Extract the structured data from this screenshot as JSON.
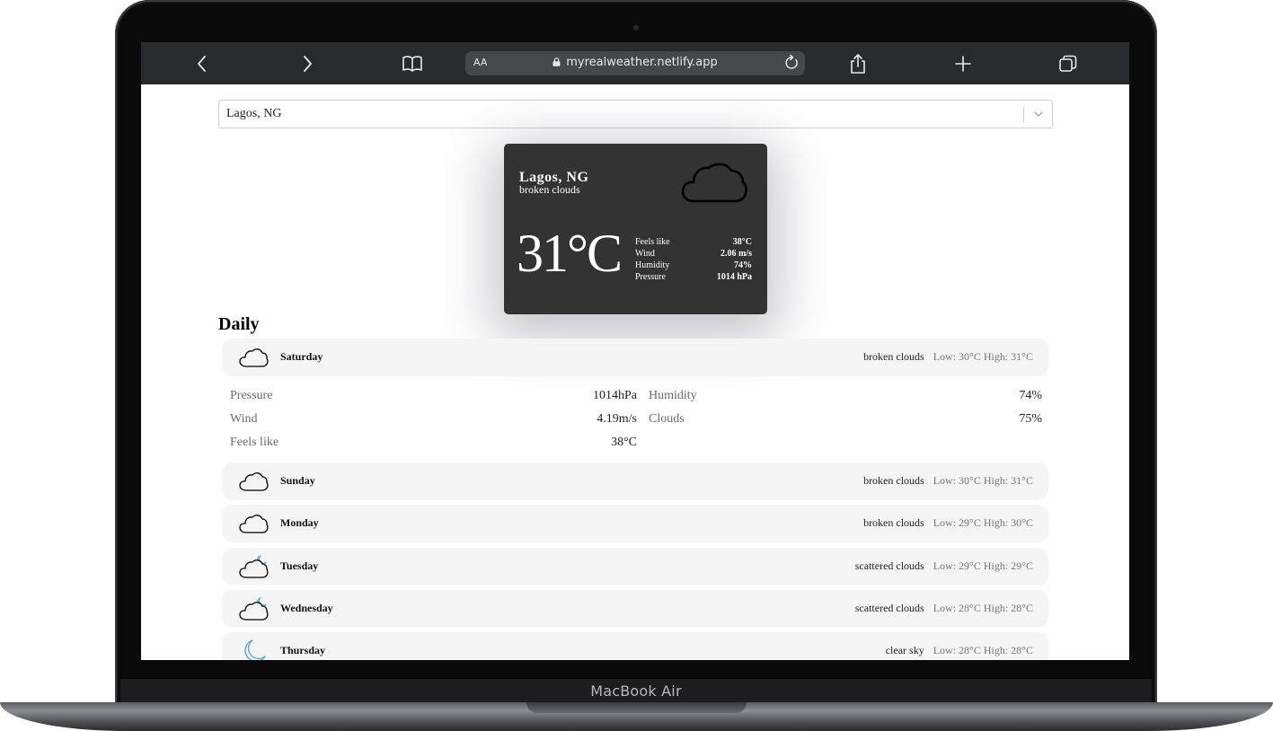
{
  "device": {
    "label": "MacBook Air"
  },
  "browser": {
    "text_size_label": "AA",
    "url": "myrealweather.netlify.app"
  },
  "location_select": {
    "value": "Lagos, NG"
  },
  "current": {
    "city": "Lagos, NG",
    "description": "broken clouds",
    "icon": "cloud-icon",
    "temperature": "31°C",
    "details": [
      {
        "label": "Feels like",
        "value": "38°C"
      },
      {
        "label": "Wind",
        "value": "2.06 m/s"
      },
      {
        "label": "Humidity",
        "value": "74%"
      },
      {
        "label": "Pressure",
        "value": "1014 hPa"
      }
    ]
  },
  "daily": {
    "title": "Daily",
    "expanded_details": {
      "left": [
        {
          "label": "Pressure",
          "value": "1014hPa"
        },
        {
          "label": "Wind",
          "value": "4.19m/s"
        },
        {
          "label": "Feels like",
          "value": "38°C"
        }
      ],
      "right": [
        {
          "label": "Humidity",
          "value": "74%"
        },
        {
          "label": "Clouds",
          "value": "75%"
        }
      ]
    },
    "days": [
      {
        "name": "Saturday",
        "icon": "cloud-icon",
        "description": "broken clouds",
        "low_high": "Low: 30°C High: 31°C"
      },
      {
        "name": "Sunday",
        "icon": "cloud-icon",
        "description": "broken clouds",
        "low_high": "Low: 30°C High: 31°C"
      },
      {
        "name": "Monday",
        "icon": "cloud-icon",
        "description": "broken clouds",
        "low_high": "Low: 29°C High: 30°C"
      },
      {
        "name": "Tuesday",
        "icon": "cloud-moon-icon",
        "description": "scattered clouds",
        "low_high": "Low: 29°C High: 29°C"
      },
      {
        "name": "Wednesday",
        "icon": "cloud-moon-icon",
        "description": "scattered clouds",
        "low_high": "Low: 28°C High: 28°C"
      },
      {
        "name": "Thursday",
        "icon": "moon-icon",
        "description": "clear sky",
        "low_high": "Low: 28°C High: 28°C"
      }
    ]
  },
  "colors": {
    "toolbar": "#292a2e",
    "card": "#333333",
    "row_background": "#f5f5f5",
    "moon_accent": "#5aa9d6"
  }
}
